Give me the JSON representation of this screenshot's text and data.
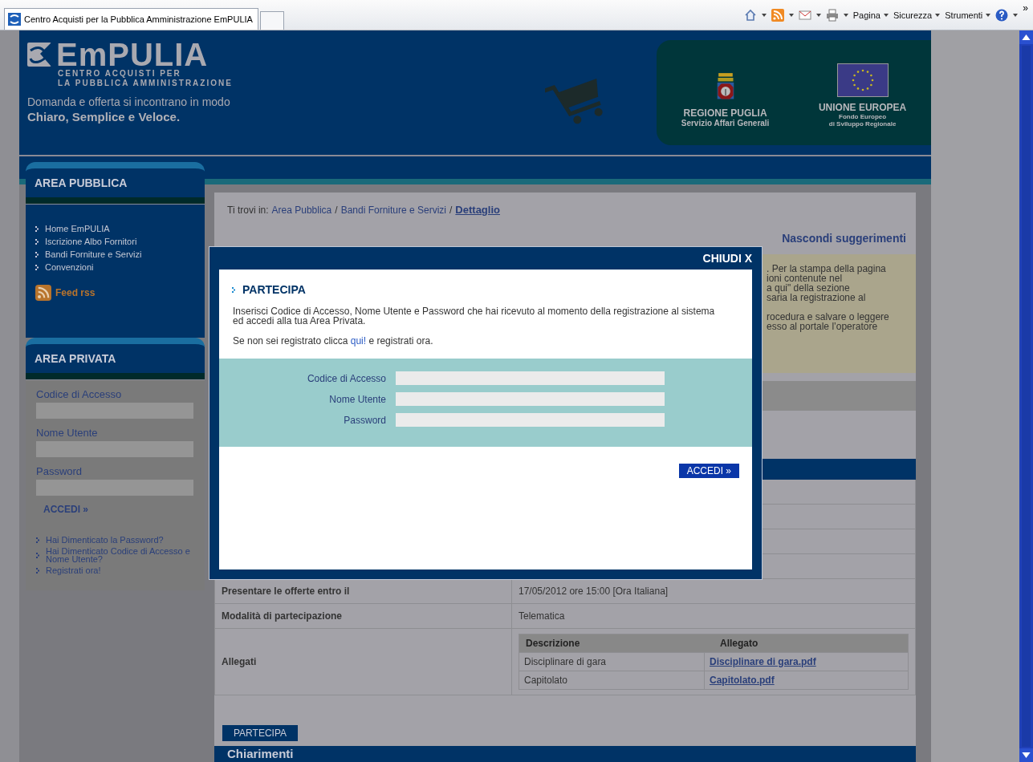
{
  "browser": {
    "tab": {
      "title": "Centro Acquisti per la Pubblica Amministrazione EmPULIA",
      "selected": true
    },
    "commands": [
      "Pagina",
      "Sicurezza",
      "Strumenti"
    ],
    "overflow": "»"
  },
  "header": {
    "logo": "EmPULIA",
    "subtitle_lines": [
      "CENTRO ACQUISTI PER",
      "LA PUBBLICA AMMINISTRAZIONE"
    ],
    "tagline": "Domanda e offerta si incontrano in modo",
    "tagline_bold": "Chiaro, Semplice e Veloce.",
    "partners": [
      {
        "kind": "region",
        "name": "REGIONE PUGLIA",
        "sub": [
          "Servizio Affari Generali"
        ]
      },
      {
        "kind": "eu",
        "name": "UNIONE EUROPEA",
        "sub": [
          "Fondo Europeo",
          "di Sviluppo Regionale"
        ]
      }
    ]
  },
  "sidebar": {
    "public": {
      "title": "AREA PUBBLICA",
      "links": [
        "Home EmPULIA",
        "Iscrizione Albo Fornitori",
        "Bandi Forniture e Servizi",
        "Convenzioni"
      ],
      "feed": "Feed rss"
    },
    "private": {
      "title": "AREA PRIVATA",
      "fields": [
        "Codice di Accesso",
        "Nome Utente",
        "Password"
      ],
      "button": "ACCEDI »",
      "links": [
        "Hai Dimenticato la Password?",
        "Hai Dimenticato Codice di Accesso e Nome Utente?",
        "Registrati ora!"
      ]
    }
  },
  "main": {
    "breadcrumb": {
      "prefix": "Ti trovi in:",
      "separator": "/",
      "items": [
        {
          "label": "Area Pubblica",
          "current": false
        },
        {
          "label": "Bandi Forniture e Servizi",
          "current": false
        },
        {
          "label": "Dettaglio",
          "current": true
        }
      ]
    },
    "toggle": "Nascondi suggerimenti",
    "suggestions": [
      [
        ". Per la stampa della pagina",
        "ioni contenute nel",
        "a qui\" della sezione",
        "saria la registrazione al"
      ],
      [
        "rocedura e salvare o leggere",
        "esso al portale l’operatore"
      ]
    ],
    "rows": [
      {
        "label": "Presentare le offerte entro il",
        "value": "17/05/2012 ore 15:00 [Ora Italiana]"
      },
      {
        "label": "Modalità di partecipazione",
        "value": "Telematica"
      }
    ],
    "attachments": {
      "label": "Allegati",
      "columns": [
        "Descrizione",
        "Allegato"
      ],
      "rows": [
        [
          "Disciplinare di gara",
          "Disciplinare di gara.pdf"
        ],
        [
          "Capitolato",
          "Capitolato.pdf"
        ]
      ]
    },
    "button": "PARTECIPA",
    "section": "Chiarimenti"
  },
  "modal": {
    "close": "CHIUDI X",
    "title": "PARTECIPA",
    "text": "Inserisci Codice di Accesso, Nome Utente e Password che hai ricevuto al momento della registrazione al sistema ed accedi alla tua Area Privata.",
    "register": {
      "before": "Se non sei registrato clicca",
      "link": "qui!",
      "after": "e registrati ora."
    },
    "fields": [
      "Codice di Accesso",
      "Nome Utente",
      "Password"
    ],
    "button": "ACCEDI »"
  }
}
